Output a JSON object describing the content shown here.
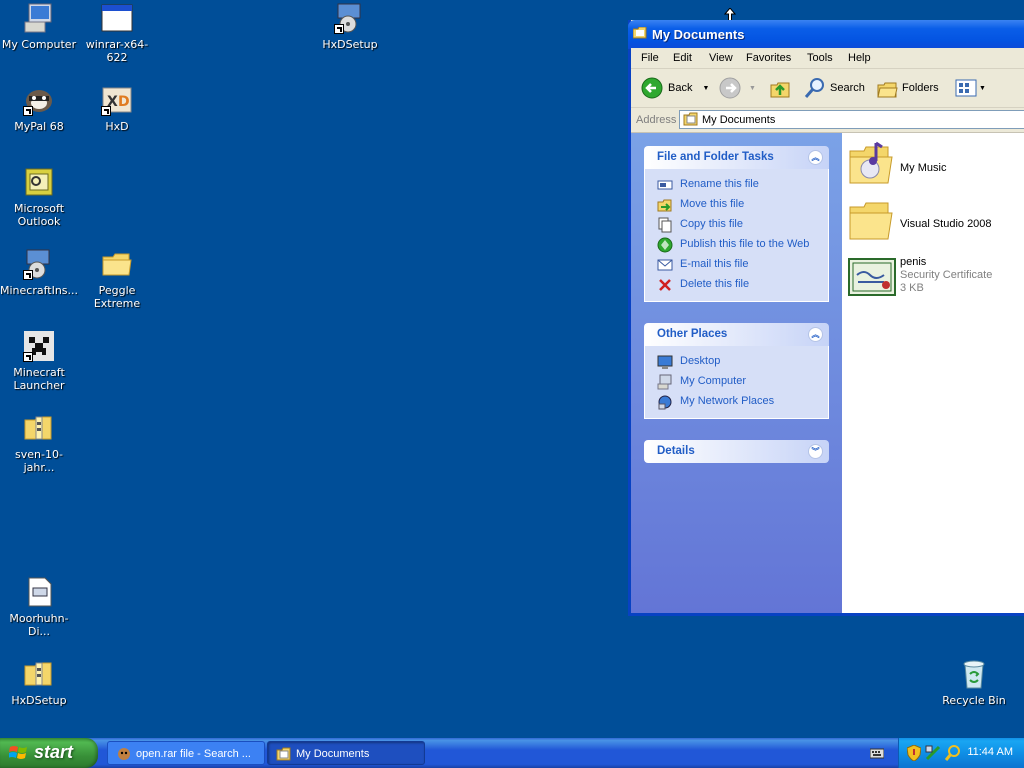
{
  "desktop": {
    "icons": [
      {
        "label": "My Computer",
        "icon": "computer-icon"
      },
      {
        "label": "winrar-x64-622",
        "icon": "exe-window-icon"
      },
      {
        "label": "HxDSetup",
        "icon": "installer-icon"
      },
      {
        "label": "MyPal 68",
        "icon": "mypal-browser-icon"
      },
      {
        "label": "HxD",
        "icon": "hxd-icon"
      },
      {
        "label": "Microsoft Outlook",
        "icon": "outlook-icon"
      },
      {
        "label": "MinecraftIns...",
        "icon": "installer-icon"
      },
      {
        "label": "Peggle Extreme",
        "icon": "folder-icon"
      },
      {
        "label": "Minecraft Launcher",
        "icon": "creeper-icon"
      },
      {
        "label": "sven-10-jahr...",
        "icon": "zip-folder-icon"
      },
      {
        "label": "Moorhuhn-Di...",
        "icon": "document-icon"
      },
      {
        "label": "HxDSetup",
        "icon": "zip-folder-icon"
      },
      {
        "label": "Recycle Bin",
        "icon": "recycle-bin-icon"
      }
    ]
  },
  "window": {
    "title": "My Documents",
    "menu": [
      "File",
      "Edit",
      "View",
      "Favorites",
      "Tools",
      "Help"
    ],
    "toolbar": {
      "back": "Back",
      "search": "Search",
      "folders": "Folders"
    },
    "address": {
      "label": "Address",
      "value": "My Documents"
    },
    "tasks": {
      "file_folder": {
        "title": "File and Folder Tasks",
        "items": [
          "Rename this file",
          "Move this file",
          "Copy this file",
          "Publish this file to the Web",
          "E-mail this file",
          "Delete this file"
        ]
      },
      "other_places": {
        "title": "Other Places",
        "items": [
          "Desktop",
          "My Computer",
          "My Network Places"
        ]
      },
      "details": {
        "title": "Details"
      }
    },
    "files": [
      {
        "name": "My Music"
      },
      {
        "name": "Visual Studio 2008"
      },
      {
        "name": "penis",
        "type": "Security Certificate",
        "size": "3 KB"
      }
    ]
  },
  "taskbar": {
    "start": "start",
    "tasks": [
      "open.rar file - Search ...",
      "My Documents"
    ],
    "clock": "11:44 AM"
  }
}
